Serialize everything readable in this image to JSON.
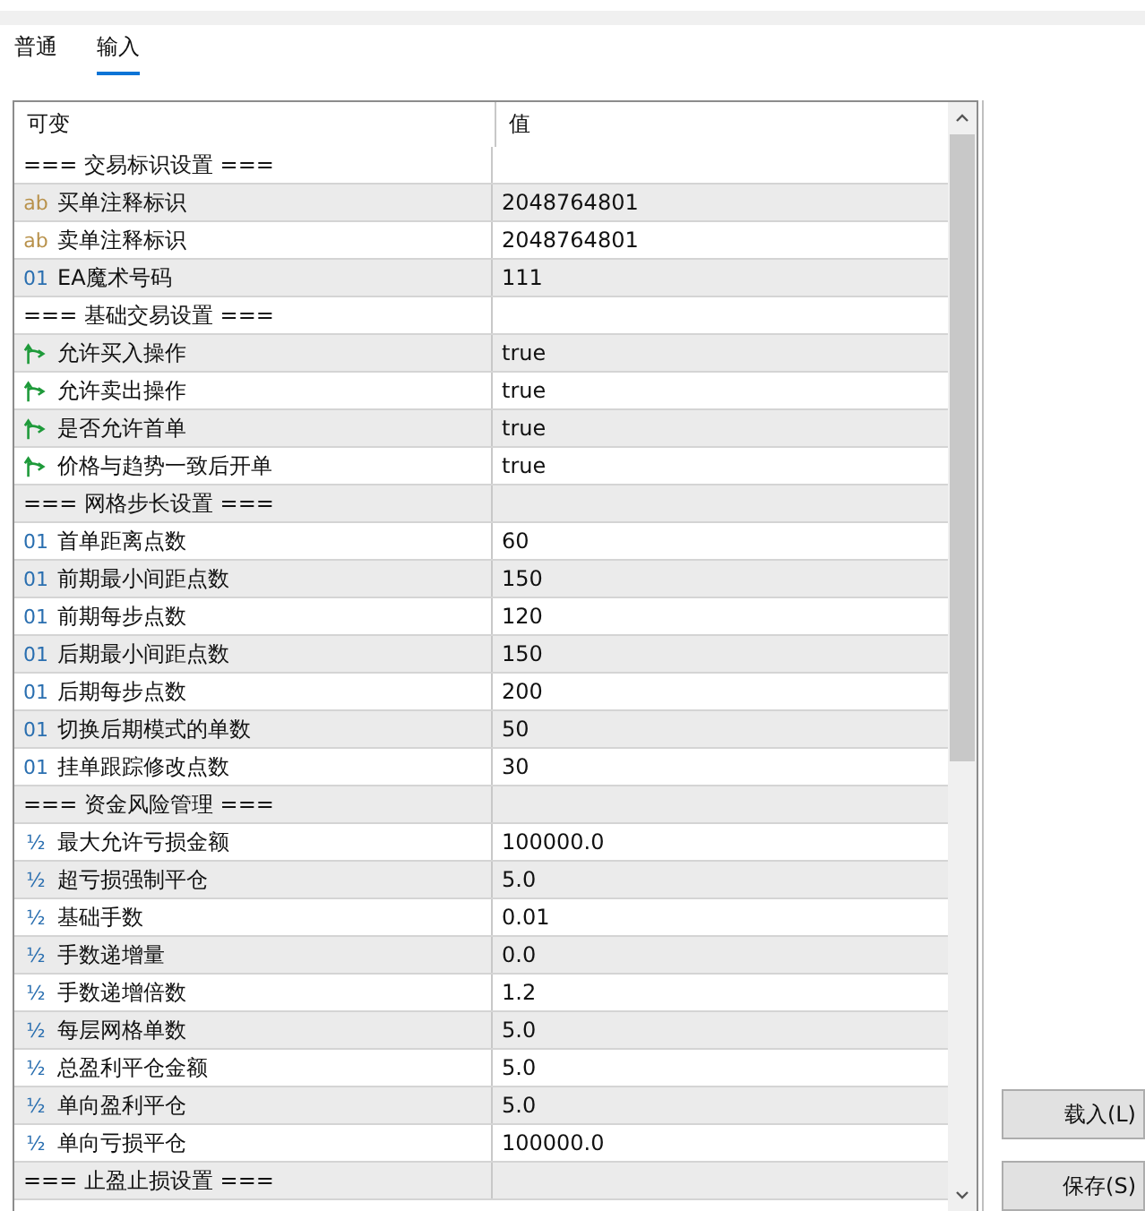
{
  "tabs": [
    {
      "label": "普通",
      "selected": false
    },
    {
      "label": "输入",
      "selected": true
    }
  ],
  "table": {
    "columns": [
      "可变",
      "值"
    ],
    "rows": [
      {
        "kind": "group",
        "name": "=== 交易标识设置 ===",
        "value": ""
      },
      {
        "kind": "string",
        "icon": "ab",
        "name": "买单注释标识",
        "value": "2048764801"
      },
      {
        "kind": "string",
        "icon": "ab",
        "name": "卖单注释标识",
        "value": "2048764801"
      },
      {
        "kind": "int",
        "icon": "01",
        "name": "EA魔术号码",
        "value": "111"
      },
      {
        "kind": "group",
        "name": "=== 基础交易设置 ===",
        "value": ""
      },
      {
        "kind": "bool",
        "name": "允许买入操作",
        "value": "true"
      },
      {
        "kind": "bool",
        "name": "允许卖出操作",
        "value": "true"
      },
      {
        "kind": "bool",
        "name": "是否允许首单",
        "value": "true"
      },
      {
        "kind": "bool",
        "name": "价格与趋势一致后开单",
        "value": "true"
      },
      {
        "kind": "group",
        "name": "=== 网格步长设置 ===",
        "value": ""
      },
      {
        "kind": "int",
        "icon": "01",
        "name": "首单距离点数",
        "value": "60"
      },
      {
        "kind": "int",
        "icon": "01",
        "name": "前期最小间距点数",
        "value": "150"
      },
      {
        "kind": "int",
        "icon": "01",
        "name": "前期每步点数",
        "value": "120"
      },
      {
        "kind": "int",
        "icon": "01",
        "name": "后期最小间距点数",
        "value": "150"
      },
      {
        "kind": "int",
        "icon": "01",
        "name": "后期每步点数",
        "value": "200"
      },
      {
        "kind": "int",
        "icon": "01",
        "name": "切换后期模式的单数",
        "value": "50"
      },
      {
        "kind": "int",
        "icon": "01",
        "name": "挂单跟踪修改点数",
        "value": "30"
      },
      {
        "kind": "group",
        "name": "=== 资金风险管理 ===",
        "value": ""
      },
      {
        "kind": "double",
        "icon": "½",
        "name": "最大允许亏损金额",
        "value": "100000.0"
      },
      {
        "kind": "double",
        "icon": "½",
        "name": "超亏损强制平仓",
        "value": "5.0"
      },
      {
        "kind": "double",
        "icon": "½",
        "name": "基础手数",
        "value": "0.01"
      },
      {
        "kind": "double",
        "icon": "½",
        "name": "手数递增量",
        "value": "0.0"
      },
      {
        "kind": "double",
        "icon": "½",
        "name": "手数递增倍数",
        "value": "1.2"
      },
      {
        "kind": "double",
        "icon": "½",
        "name": "每层网格单数",
        "value": "5.0"
      },
      {
        "kind": "double",
        "icon": "½",
        "name": "总盈利平仓金额",
        "value": "5.0"
      },
      {
        "kind": "double",
        "icon": "½",
        "name": "单向盈利平仓",
        "value": "5.0"
      },
      {
        "kind": "double",
        "icon": "½",
        "name": "单向亏损平仓",
        "value": "100000.0"
      },
      {
        "kind": "group",
        "name": "=== 止盈止损设置 ===",
        "value": ""
      }
    ]
  },
  "buttons": [
    "载入(L)",
    "保存(S)"
  ]
}
